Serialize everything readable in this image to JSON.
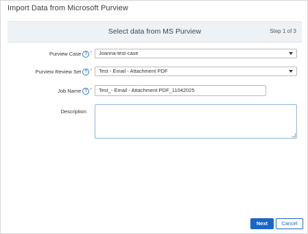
{
  "dialog": {
    "title": "Import Data from Microsoft Purview",
    "header_title": "Select data from MS Purview",
    "step": "Step 1 of 3"
  },
  "form": {
    "purview_case": {
      "label": "Purview Case",
      "value": "Joanna-test-case"
    },
    "review_set": {
      "label": "Purview Review Set",
      "value": "Test - Email - Attachment PDF"
    },
    "job_name": {
      "label": "Job Name",
      "value": "Test_- Email - Attachment PDF_11042025"
    },
    "description": {
      "label": "Description",
      "value": ""
    },
    "help_glyph": "?",
    "required_mark": "*"
  },
  "buttons": {
    "next": "Next",
    "cancel": "Cancel"
  },
  "colors": {
    "accent": "#1a66c7",
    "required": "#d9534f",
    "header_bg": "#eef2f5"
  },
  "icons": [
    "help-icon",
    "chevron-down-icon",
    "resize-handle-icon"
  ]
}
